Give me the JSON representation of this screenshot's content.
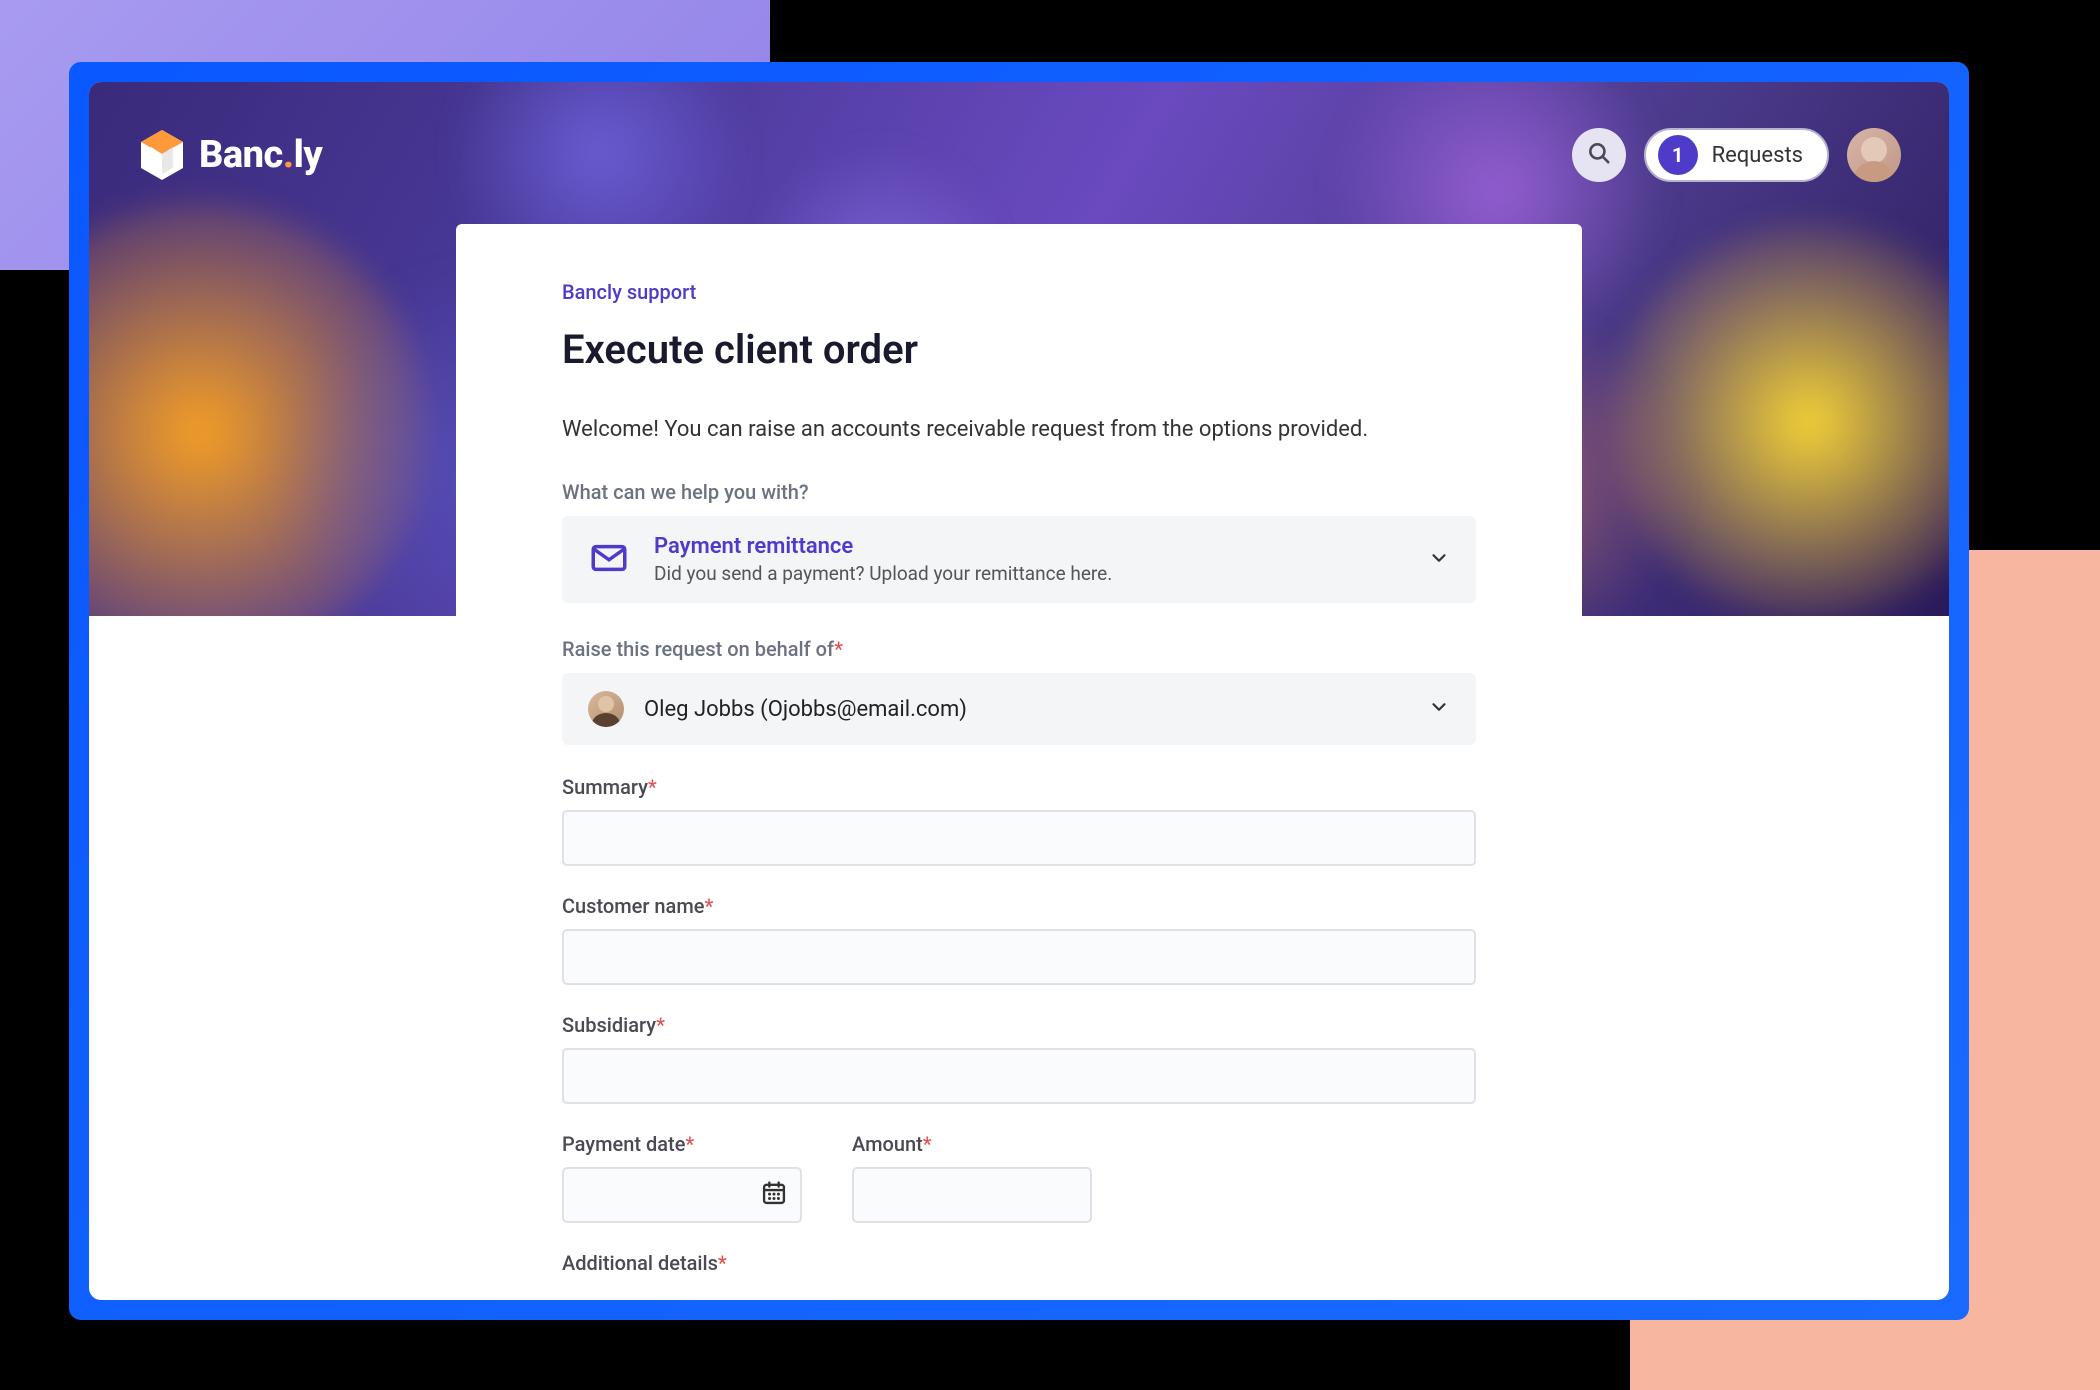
{
  "brand": {
    "name_part1": "Banc",
    "name_dot": ".",
    "name_part2": "ly"
  },
  "header": {
    "requests_count": "1",
    "requests_label": "Requests"
  },
  "page": {
    "breadcrumb": "Bancly support",
    "title": "Execute client order",
    "welcome": "Welcome! You can raise an accounts receivable request from the options provided."
  },
  "sections": {
    "help_with": "What can we help you with?",
    "on_behalf": "Raise this request on behalf of"
  },
  "help_option": {
    "title": "Payment remittance",
    "subtitle": "Did you send a payment? Upload your remittance here."
  },
  "requester": {
    "name": "Oleg Jobbs (Ojobbs@email.com)"
  },
  "fields": {
    "summary": {
      "label": "Summary",
      "value": ""
    },
    "customer_name": {
      "label": "Customer name",
      "value": ""
    },
    "subsidiary": {
      "label": "Subsidiary",
      "value": ""
    },
    "payment_date": {
      "label": "Payment date",
      "value": ""
    },
    "amount": {
      "label": "Amount",
      "value": ""
    },
    "additional_details": {
      "label": "Additional details",
      "value": ""
    }
  },
  "required_marker": "*"
}
